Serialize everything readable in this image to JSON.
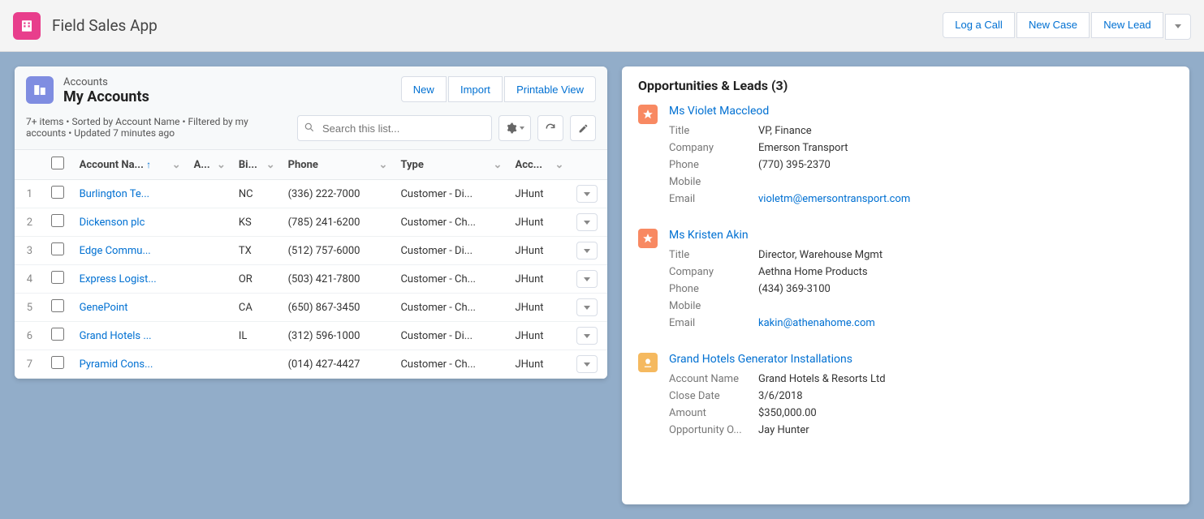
{
  "app": {
    "title": "Field Sales App"
  },
  "global_actions": {
    "log_call": "Log a Call",
    "new_case": "New Case",
    "new_lead": "New Lead"
  },
  "listview": {
    "object_label": "Accounts",
    "view_name": "My Accounts",
    "meta": "7+ items • Sorted by Account Name • Filtered by my accounts • Updated 7 minutes ago",
    "buttons": {
      "new": "New",
      "import": "Import",
      "printable": "Printable View"
    },
    "search_placeholder": "Search this list...",
    "columns": {
      "name": "Account Na...",
      "a": "A...",
      "bi": "Bi...",
      "phone": "Phone",
      "type": "Type",
      "acc": "Acc..."
    },
    "rows": [
      {
        "idx": "1",
        "name": "Burlington Te...",
        "state": "NC",
        "phone": "(336) 222-7000",
        "type": "Customer - Di...",
        "owner": "JHunt"
      },
      {
        "idx": "2",
        "name": "Dickenson plc",
        "state": "KS",
        "phone": "(785) 241-6200",
        "type": "Customer - Ch...",
        "owner": "JHunt"
      },
      {
        "idx": "3",
        "name": "Edge Commu...",
        "state": "TX",
        "phone": "(512) 757-6000",
        "type": "Customer - Di...",
        "owner": "JHunt"
      },
      {
        "idx": "4",
        "name": "Express Logist...",
        "state": "OR",
        "phone": "(503) 421-7800",
        "type": "Customer - Ch...",
        "owner": "JHunt"
      },
      {
        "idx": "5",
        "name": "GenePoint",
        "state": "CA",
        "phone": "(650) 867-3450",
        "type": "Customer - Ch...",
        "owner": "JHunt"
      },
      {
        "idx": "6",
        "name": "Grand Hotels ...",
        "state": "IL",
        "phone": "(312) 596-1000",
        "type": "Customer - Di...",
        "owner": "JHunt"
      },
      {
        "idx": "7",
        "name": "Pyramid Cons...",
        "state": "",
        "phone": "(014) 427-4427",
        "type": "Customer - Ch...",
        "owner": "JHunt"
      }
    ]
  },
  "related": {
    "title": "Opportunities & Leads (3)",
    "labels": {
      "title": "Title",
      "company": "Company",
      "phone": "Phone",
      "mobile": "Mobile",
      "email": "Email",
      "account_name": "Account Name",
      "close_date": "Close Date",
      "amount": "Amount",
      "opp_owner": "Opportunity O..."
    },
    "records": [
      {
        "kind": "lead",
        "name": "Ms Violet Maccleod",
        "fields": {
          "title": "VP, Finance",
          "company": "Emerson Transport",
          "phone": "(770) 395-2370",
          "mobile": "",
          "email": "violetm@emersontransport.com"
        }
      },
      {
        "kind": "lead",
        "name": "Ms Kristen Akin",
        "fields": {
          "title": "Director, Warehouse Mgmt",
          "company": "Aethna Home Products",
          "phone": "(434) 369-3100",
          "mobile": "",
          "email": "kakin@athenahome.com"
        }
      },
      {
        "kind": "opportunity",
        "name": "Grand Hotels Generator Installations",
        "fields": {
          "account_name": "Grand Hotels & Resorts Ltd",
          "close_date": "3/6/2018",
          "amount": "$350,000.00",
          "opp_owner": "Jay Hunter"
        }
      }
    ]
  }
}
